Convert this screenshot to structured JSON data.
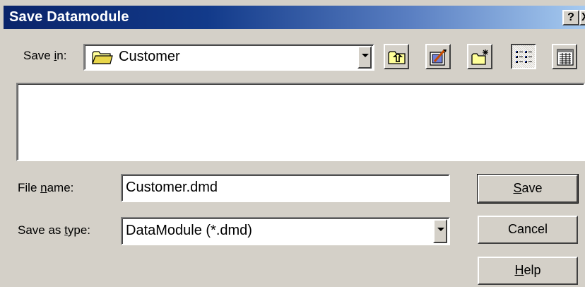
{
  "window": {
    "title": "Save Datamodule",
    "help_button": "?",
    "close_button": "X"
  },
  "save_in": {
    "label_prefix": "Save ",
    "label_mnemonic": "i",
    "label_suffix": "n:",
    "value": "Customer",
    "icon": "folder-icon"
  },
  "toolbar": {
    "buttons": [
      {
        "name": "up-one-level-icon"
      },
      {
        "name": "desktop-icon"
      },
      {
        "name": "create-new-folder-icon"
      },
      {
        "name": "list-view-icon"
      },
      {
        "name": "details-view-icon"
      }
    ]
  },
  "file_name": {
    "label_prefix": "File ",
    "label_mnemonic": "n",
    "label_suffix": "ame:",
    "value": "Customer.dmd"
  },
  "save_as_type": {
    "label_prefix": "Save as ",
    "label_mnemonic": "t",
    "label_suffix": "ype:",
    "value": "DataModule (*.dmd)"
  },
  "buttons": {
    "save_mnemonic": "S",
    "save_rest": "ave",
    "cancel": "Cancel",
    "help_mnemonic": "H",
    "help_rest": "elp"
  },
  "colors": {
    "titlebar_start": "#0a246a",
    "titlebar_end": "#a6caf0",
    "dialog_bg": "#d4d0c8"
  }
}
